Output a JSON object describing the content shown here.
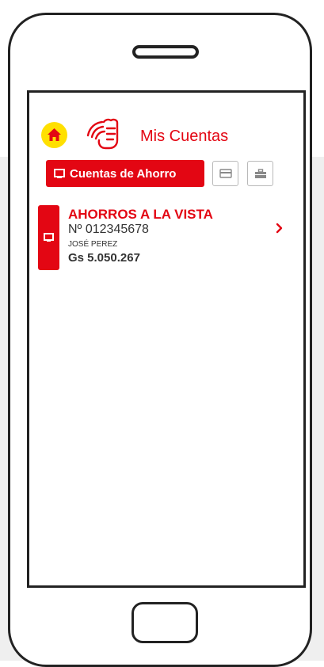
{
  "header": {
    "title": "Mis Cuentas",
    "home_icon": "home-icon",
    "brand_icon": "wave-hand-icon",
    "accent_color": "#e30613",
    "home_color": "#ffe000"
  },
  "tabs": [
    {
      "label": "Cuentas de Ahorro",
      "icon": "savings-icon",
      "active": true
    },
    {
      "label": "",
      "icon": "credit-card-icon",
      "active": false
    },
    {
      "label": "",
      "icon": "briefcase-icon",
      "active": false
    }
  ],
  "accounts": [
    {
      "type": "AHORROS A LA VISTA",
      "number": "Nº 012345678",
      "holder": "JOSÉ PEREZ",
      "balance": "Gs 5.050.267",
      "icon": "savings-icon"
    }
  ]
}
